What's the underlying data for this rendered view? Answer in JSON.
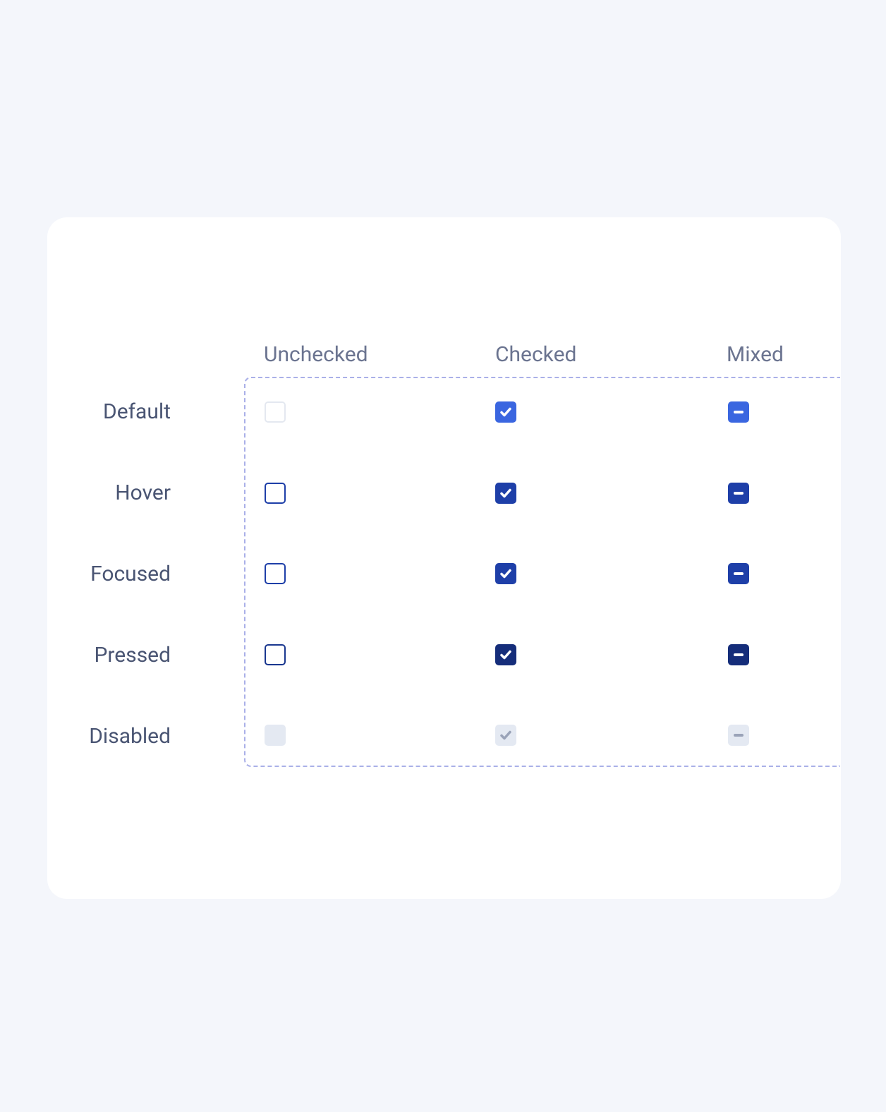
{
  "columns": {
    "unchecked": "Unchecked",
    "checked": "Checked",
    "mixed": "Mixed"
  },
  "rows": {
    "default": "Default",
    "hover": "Hover",
    "focused": "Focused",
    "pressed": "Pressed",
    "disabled": "Disabled"
  }
}
